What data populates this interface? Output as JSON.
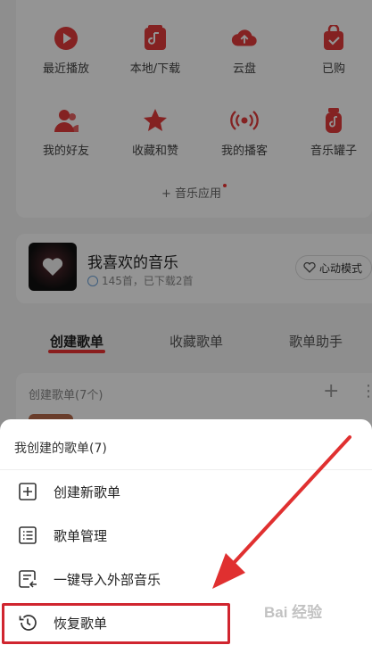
{
  "shortcuts": [
    {
      "label": "最近播放",
      "icon": "play-circle-icon"
    },
    {
      "label": "本地/下载",
      "icon": "music-file-icon"
    },
    {
      "label": "云盘",
      "icon": "cloud-upload-icon"
    },
    {
      "label": "已购",
      "icon": "shopping-bag-icon"
    },
    {
      "label": "我的好友",
      "icon": "friends-icon"
    },
    {
      "label": "收藏和赞",
      "icon": "star-icon"
    },
    {
      "label": "我的播客",
      "icon": "broadcast-icon"
    },
    {
      "label": "音乐罐子",
      "icon": "music-jar-icon"
    }
  ],
  "music_app_label": "+ 音乐应用",
  "favorite": {
    "title": "我喜欢的音乐",
    "subtitle": "145首，已下载2首",
    "heart_mode": "心动模式"
  },
  "tabs": [
    "创建歌单",
    "收藏歌单",
    "歌单助手"
  ],
  "playlist_section": {
    "header": "创建歌单(7个)"
  },
  "sheet": {
    "title": "我创建的歌单(7)",
    "items": [
      {
        "label": "创建新歌单",
        "icon": "add-square-icon"
      },
      {
        "label": "歌单管理",
        "icon": "list-manage-icon"
      },
      {
        "label": "一键导入外部音乐",
        "icon": "import-icon"
      },
      {
        "label": "恢复歌单",
        "icon": "restore-clock-icon"
      }
    ]
  },
  "watermark": "Bai 经验",
  "colors": {
    "accent": "#e33b3b",
    "highlight": "#d0252f"
  }
}
